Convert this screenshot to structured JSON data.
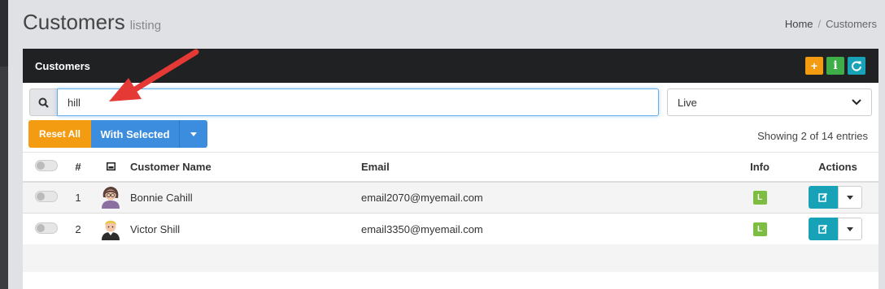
{
  "header": {
    "title": "Customers",
    "subtitle": "listing"
  },
  "breadcrumb": {
    "home": "Home",
    "separator": "/",
    "current": "Customers"
  },
  "panel": {
    "title": "Customers",
    "tools": [
      {
        "icon": "plus-icon",
        "glyph": "+",
        "color": "#f39c12"
      },
      {
        "icon": "info-icon",
        "glyph": "i",
        "color": "#3fae49"
      },
      {
        "icon": "refresh-icon",
        "glyph": "C",
        "color": "#17a2b8"
      }
    ]
  },
  "search": {
    "value": "hill",
    "placeholder": ""
  },
  "status_filter": {
    "selected": "Live"
  },
  "buttons": {
    "reset_all": "Reset All",
    "with_selected": "With Selected"
  },
  "showing": "Showing 2 of 14 entries",
  "table": {
    "columns": {
      "num": "#",
      "name": "Customer Name",
      "email": "Email",
      "info": "Info",
      "actions": "Actions"
    },
    "rows": [
      {
        "num": "1",
        "name": "Bonnie Cahill",
        "email": "email2070@myemail.com",
        "info": "L"
      },
      {
        "num": "2",
        "name": "Victor Shill",
        "email": "email3350@myemail.com",
        "info": "L"
      }
    ]
  },
  "colors": {
    "orange": "#f39c12",
    "blue": "#3c8dde",
    "teal": "#17a2b8",
    "green": "#7cbd42",
    "arrow": "#e53935"
  }
}
